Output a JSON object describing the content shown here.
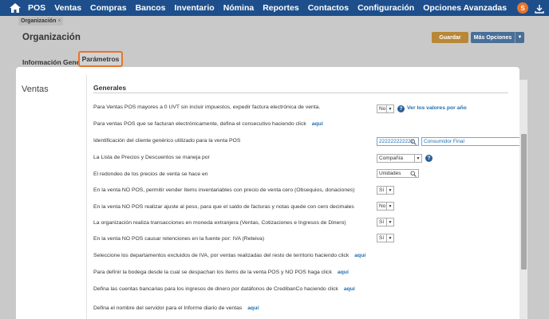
{
  "nav": {
    "items": [
      "POS",
      "Ventas",
      "Compras",
      "Bancos",
      "Inventario",
      "Nómina",
      "Reportes",
      "Contactos",
      "Configuración",
      "Opciones Avanzadas"
    ],
    "avatar_letter": "S"
  },
  "page": {
    "tab_label": "Organización",
    "tab_close": "×",
    "title": "Organización",
    "save_label": "Guardar",
    "more_options_label": "Más Opciones",
    "subtabs": {
      "info": "Información General",
      "params": "Parámetros"
    }
  },
  "modal": {
    "side_title": "Ventas",
    "section_title": "Generales",
    "rows": [
      {
        "label": "Para Ventas POS mayores a 0 UVT sin incluir impuestos, expedir factura electrónica de venta.",
        "select": "No",
        "help_link": "Ver los valores por año"
      },
      {
        "label": "Para ventas POS que se facturan electrónicamente, defina el consecutivo haciendo click",
        "link": "aquí"
      },
      {
        "label": "Identificación del cliente genérico utilizado para la venta POS",
        "input": "222222222222",
        "input2": "Consumidor Final"
      },
      {
        "label": "La Lista de Precios y Descuentos se maneja por",
        "select": "Compañía"
      },
      {
        "label": "El redondeo de los precios de venta se hace en",
        "input": "Unidades"
      },
      {
        "label": "En la venta NO POS, permitir vender ítems inventariables con precio de venta cero (Obsequios, donaciones)",
        "select": "Sí"
      },
      {
        "label": "En la venta NO POS realizar ajuste al peso, para que el saldo de facturas y notas quede con cero decimales",
        "select": "No"
      },
      {
        "label": "La organización realiza transacciones en moneda extranjera (Ventas, Cotizaciones e Ingresos de Dinero)",
        "select": "Sí"
      },
      {
        "label": "En la venta NO POS causar retenciones en la fuente por: IVA (Reteiva)",
        "select": "Sí"
      },
      {
        "label": "Seleccione los departamentos excluidos de IVA, por ventas realizadas del resto de territorio haciendo click",
        "link": "aquí"
      },
      {
        "label": "Para definir la bodega desde la cual se despachan los ítems de la venta POS y NO POS haga click",
        "link": "aquí"
      },
      {
        "label": "Defina las cuentas bancarias para los ingresos de dinero por datáfonos de CredibanCo haciendo click",
        "link": "aquí"
      },
      {
        "label": "Defina el nombre del servidor para el Informe diario de ventas",
        "link": "aquí"
      }
    ]
  },
  "colors": {
    "nav_bg": "#1e4f8c",
    "accent": "#e8742b",
    "link": "#1f6fb2"
  },
  "icons": [
    "home-icon",
    "download-icon",
    "search-icon",
    "help-icon",
    "chevron-down-icon"
  ]
}
